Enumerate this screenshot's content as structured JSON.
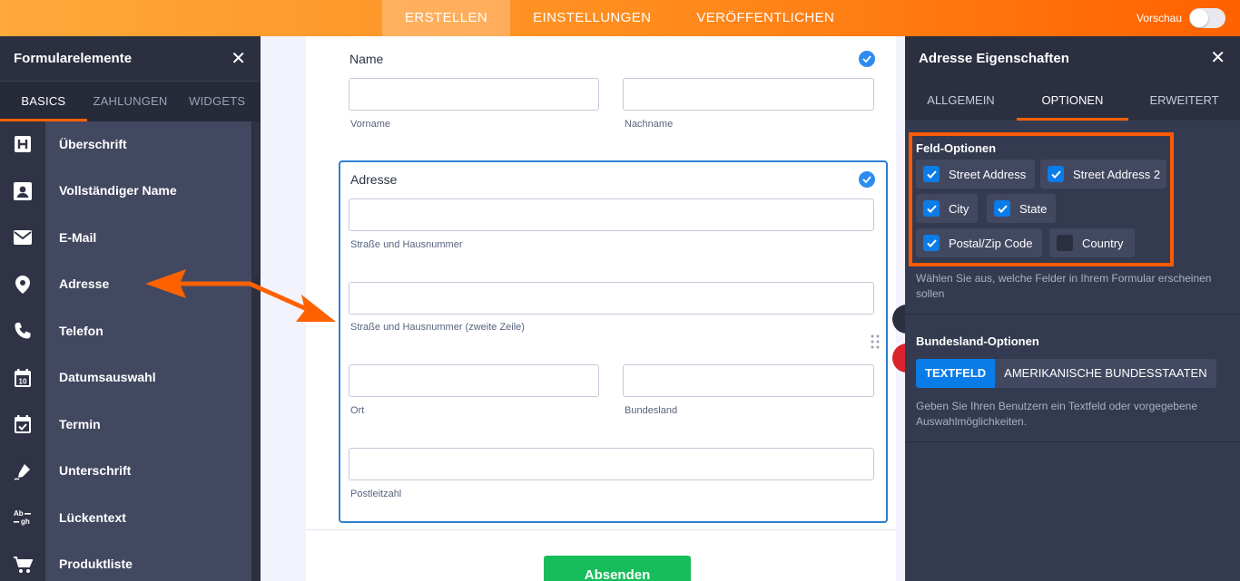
{
  "topbar": {
    "tabs": [
      {
        "label": "ERSTELLEN",
        "active": true
      },
      {
        "label": "EINSTELLUNGEN",
        "active": false
      },
      {
        "label": "VERÖFFENTLICHEN",
        "active": false
      }
    ],
    "preview_label": "Vorschau"
  },
  "left_panel": {
    "title": "Formularelemente",
    "tabs": [
      {
        "label": "BASICS",
        "active": true
      },
      {
        "label": "ZAHLUNGEN",
        "active": false
      },
      {
        "label": "WIDGETS",
        "active": false
      }
    ],
    "items": [
      {
        "label": "Überschrift",
        "icon": "heading-icon"
      },
      {
        "label": "Vollständiger Name",
        "icon": "person-card-icon"
      },
      {
        "label": "E-Mail",
        "icon": "envelope-icon"
      },
      {
        "label": "Adresse",
        "icon": "map-pin-icon"
      },
      {
        "label": "Telefon",
        "icon": "phone-icon"
      },
      {
        "label": "Datumsauswahl",
        "icon": "calendar-icon"
      },
      {
        "label": "Termin",
        "icon": "calendar-check-icon"
      },
      {
        "label": "Unterschrift",
        "icon": "pen-icon"
      },
      {
        "label": "Lückentext",
        "icon": "fill-blank-icon"
      },
      {
        "label": "Produktliste",
        "icon": "cart-icon"
      }
    ]
  },
  "form": {
    "name_field": {
      "label": "Name",
      "first_sub": "Vorname",
      "last_sub": "Nachname"
    },
    "address_field": {
      "label": "Adresse",
      "street_sub": "Straße und Hausnummer",
      "street2_sub": "Straße und Hausnummer (zweite Zeile)",
      "city_sub": "Ort",
      "state_sub": "Bundesland",
      "zip_sub": "Postleitzahl"
    },
    "submit_label": "Absenden"
  },
  "right_panel": {
    "title": "Adresse Eigenschaften",
    "tabs": [
      {
        "label": "ALLGEMEIN",
        "active": false
      },
      {
        "label": "OPTIONEN",
        "active": true
      },
      {
        "label": "ERWEITERT",
        "active": false
      }
    ],
    "field_options": {
      "title": "Feld-Optionen",
      "options": [
        {
          "label": "Street Address",
          "checked": true
        },
        {
          "label": "Street Address 2",
          "checked": true
        },
        {
          "label": "City",
          "checked": true
        },
        {
          "label": "State",
          "checked": true
        },
        {
          "label": "Postal/Zip Code",
          "checked": true
        },
        {
          "label": "Country",
          "checked": false
        }
      ],
      "help": "Wählen Sie aus, welche Felder in Ihrem Formular erscheinen sollen"
    },
    "state_options": {
      "title": "Bundesland-Optionen",
      "buttons": [
        {
          "label": "TEXTFELD",
          "active": true
        },
        {
          "label": "AMERIKANISCHE BUNDESSTAATEN",
          "active": false
        }
      ],
      "help": "Geben Sie Ihren Benutzern ein Textfeld oder vorgegebene Auswahlmöglichkeiten."
    }
  },
  "colors": {
    "accent_orange": "#ff6100",
    "panel_dark": "#2b2f40",
    "check_blue": "#0a7ce8",
    "submit_green": "#18bd5b"
  }
}
